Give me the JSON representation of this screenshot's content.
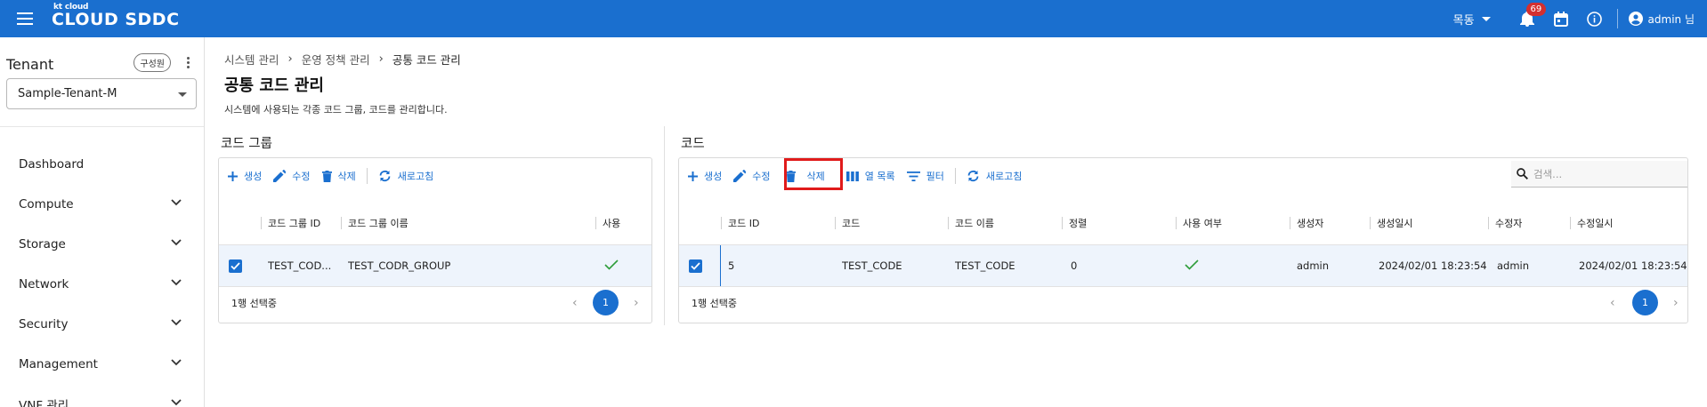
{
  "header": {
    "logo_small": "kt cloud",
    "logo_main": "CLOUD SDDC",
    "language": "목동",
    "notification_count": "69",
    "user": "admin 님"
  },
  "sidebar": {
    "tenant_title": "Tenant",
    "role_chip": "구성원",
    "tenant_selected": "Sample-Tenant-M",
    "items": [
      {
        "label": "Dashboard"
      },
      {
        "label": "Compute"
      },
      {
        "label": "Storage"
      },
      {
        "label": "Network"
      },
      {
        "label": "Security"
      },
      {
        "label": "Management"
      },
      {
        "label": "VNF 관리"
      }
    ]
  },
  "breadcrumb": [
    "시스템 관리",
    "운영 정책 관리",
    "공통 코드 관리"
  ],
  "page": {
    "title": "공통 코드 관리",
    "description": "시스템에 사용되는 각종 코드 그룹, 코드를 관리합니다."
  },
  "group_panel": {
    "title": "코드 그룹",
    "toolbar": {
      "create": "생성",
      "edit": "수정",
      "delete": "삭제",
      "refresh": "새로고침"
    },
    "columns": [
      "코드 그룹 ID",
      "코드 그룹 이름",
      "사용"
    ],
    "rows": [
      {
        "id": "TEST_COD...",
        "name": "TEST_CODR_GROUP",
        "used": true
      }
    ],
    "footer_selected": "1행 선택중",
    "page": "1"
  },
  "code_panel": {
    "title": "코드",
    "toolbar": {
      "create": "생성",
      "edit": "수정",
      "delete": "삭제",
      "columns": "열 목록",
      "filter": "필터",
      "refresh": "새로고침"
    },
    "search_placeholder": "검색...",
    "columns": [
      "코드 ID",
      "코드",
      "코드 이름",
      "정렬",
      "사용 여부",
      "생성자",
      "생성일시",
      "수정자",
      "수정일시"
    ],
    "rows": [
      {
        "code_id": "5",
        "code": "TEST_CODE",
        "code_name": "TEST_CODE",
        "sort": "0",
        "used": true,
        "creator": "admin",
        "created_at": "2024/02/01 18:23:54",
        "modifier": "admin",
        "modified_at": "2024/02/01 18:23:54"
      }
    ],
    "footer_selected": "1행 선택중",
    "page": "1"
  },
  "colors": {
    "primary": "#1a6fcf",
    "highlight": "#e01b1b",
    "selected_row": "#eef4fc",
    "check_green": "#2e9d3a"
  }
}
